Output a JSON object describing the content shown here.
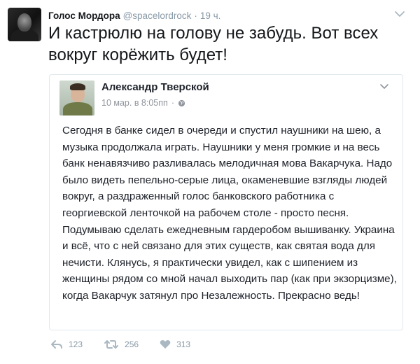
{
  "tweet": {
    "author_name": "Голос Мордора",
    "handle": "@spacelordrock",
    "separator": "·",
    "time": "19 ч.",
    "text": "И кастрюлю на голову не забудь. Вот всех вокруг корёжить будет!"
  },
  "quoted_post": {
    "author_name": "Александр Тверской",
    "date": "10 мар. в 8:05пп",
    "separator": "·",
    "text": "Сегодня в банке сидел в очереди и спустил наушники на шею, а музыка продолжала играть. Наушники у меня громкие и на весь банк ненавязчиво разливалась мелодичная мова Вакарчука. Надо было видеть пепельно-серые лица, окаменевшие взгляды людей вокруг, а раздраженный голос банковского работника с георгиевской ленточкой на рабочем столе - просто песня. Подумываю сделать ежедневным гардеробом вышиванку. Украина и всё, что с ней связано для этих существ, как святая вода для нечисти. Клянусь, я практически увидел, как с шипением из женщины рядом со мной начал выходить пар (как при экзорцизме), когда Вакарчук затянул про Незалежность. Прекрасно ведь!"
  },
  "actions": {
    "reply_count": "123",
    "retweet_count": "256",
    "like_count": "313"
  },
  "icons": {
    "caret": "chevron-down-icon",
    "globe": "globe-icon",
    "reply": "reply-icon",
    "retweet": "retweet-icon",
    "like": "heart-icon"
  },
  "colors": {
    "text": "#14171a",
    "muted": "#8899a6",
    "border": "#e1e8ed"
  }
}
